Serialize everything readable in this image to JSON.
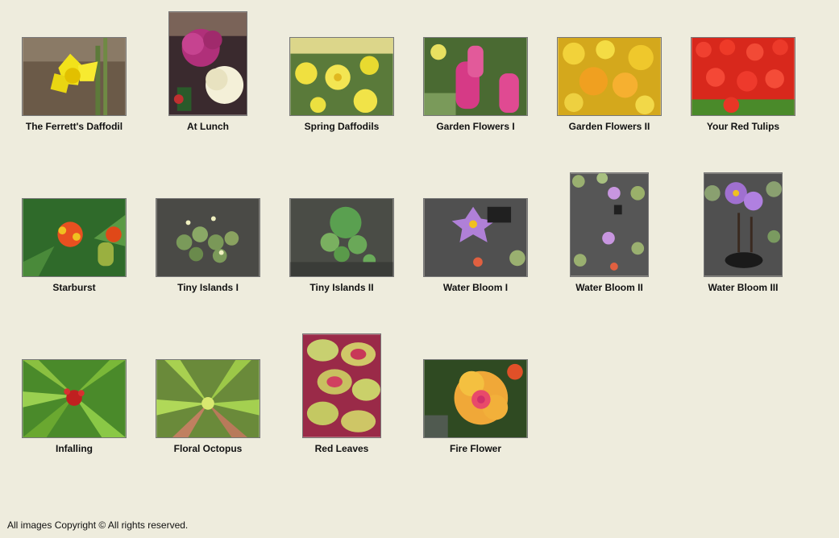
{
  "gallery": {
    "items": [
      {
        "title": "The Ferrett's Daffodil"
      },
      {
        "title": "At Lunch"
      },
      {
        "title": "Spring Daffodils"
      },
      {
        "title": "Garden Flowers I"
      },
      {
        "title": "Garden Flowers II"
      },
      {
        "title": "Your Red Tulips"
      },
      {
        "title": "Starburst"
      },
      {
        "title": "Tiny Islands I"
      },
      {
        "title": "Tiny Islands II"
      },
      {
        "title": "Water Bloom I"
      },
      {
        "title": "Water Bloom II"
      },
      {
        "title": "Water Bloom III"
      },
      {
        "title": "Infalling"
      },
      {
        "title": "Floral Octopus"
      },
      {
        "title": "Red Leaves"
      },
      {
        "title": "Fire Flower"
      }
    ]
  },
  "footer": {
    "text": "All images Copyright © All rights reserved."
  }
}
